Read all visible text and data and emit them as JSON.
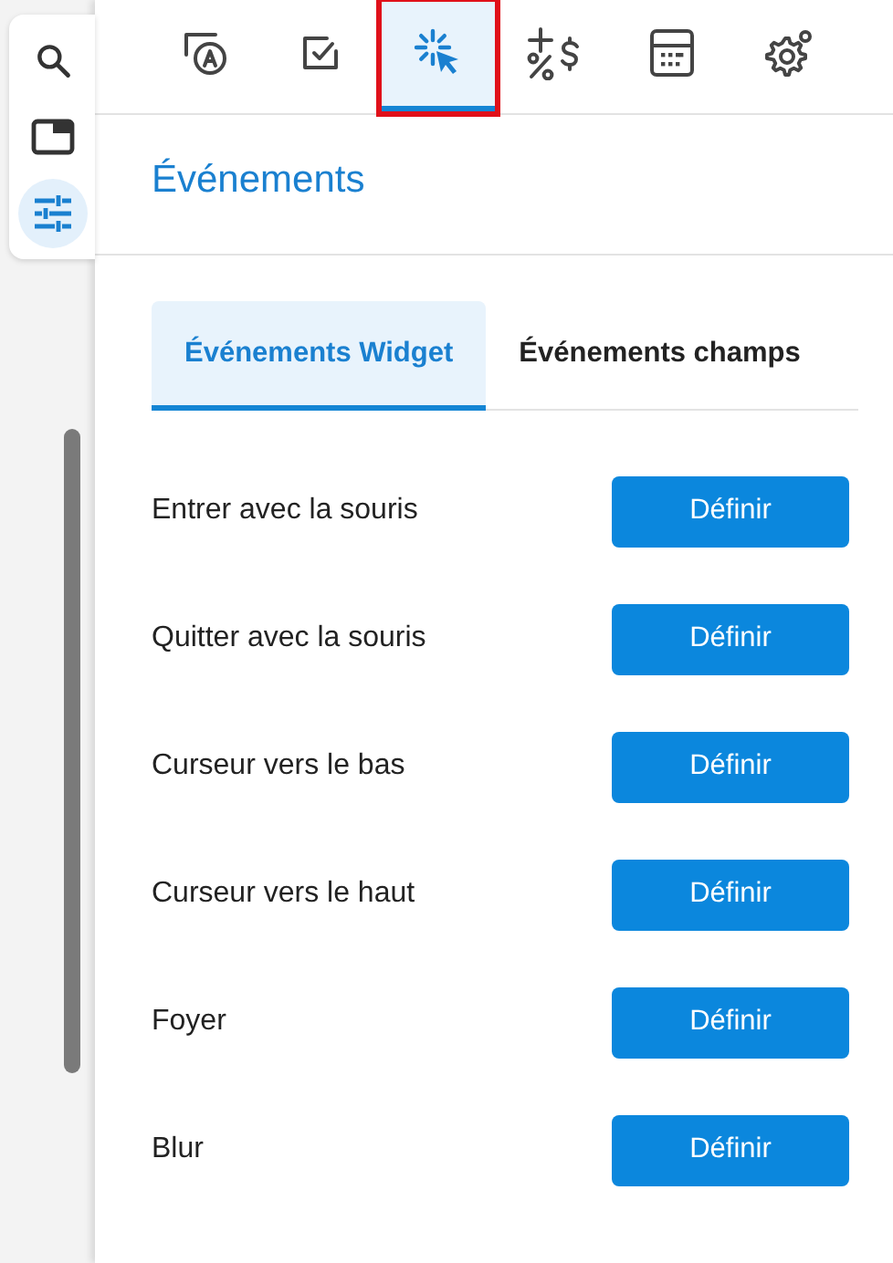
{
  "sidebar": {
    "items": [
      {
        "kind": "search",
        "selected": false
      },
      {
        "kind": "window",
        "selected": false
      },
      {
        "kind": "sliders",
        "selected": true
      }
    ]
  },
  "toolbar": {
    "tabs": [
      {
        "kind": "label",
        "selected": false,
        "highlighted": false
      },
      {
        "kind": "checkbox",
        "selected": false,
        "highlighted": false
      },
      {
        "kind": "click",
        "selected": true,
        "highlighted": true
      },
      {
        "kind": "math",
        "selected": false,
        "highlighted": false
      },
      {
        "kind": "calculator",
        "selected": false,
        "highlighted": false
      },
      {
        "kind": "gear",
        "selected": false,
        "highlighted": false
      }
    ]
  },
  "title": "Événements",
  "subtabs": [
    {
      "label": "Événements Widget",
      "selected": true
    },
    {
      "label": "Événements champs",
      "selected": false
    }
  ],
  "events": [
    {
      "label": "Entrer avec la souris",
      "button": "Définir"
    },
    {
      "label": "Quitter avec la souris",
      "button": "Définir"
    },
    {
      "label": "Curseur vers le bas",
      "button": "Définir"
    },
    {
      "label": "Curseur vers le haut",
      "button": "Définir"
    },
    {
      "label": "Foyer",
      "button": "Définir"
    },
    {
      "label": "Blur",
      "button": "Définir"
    }
  ]
}
